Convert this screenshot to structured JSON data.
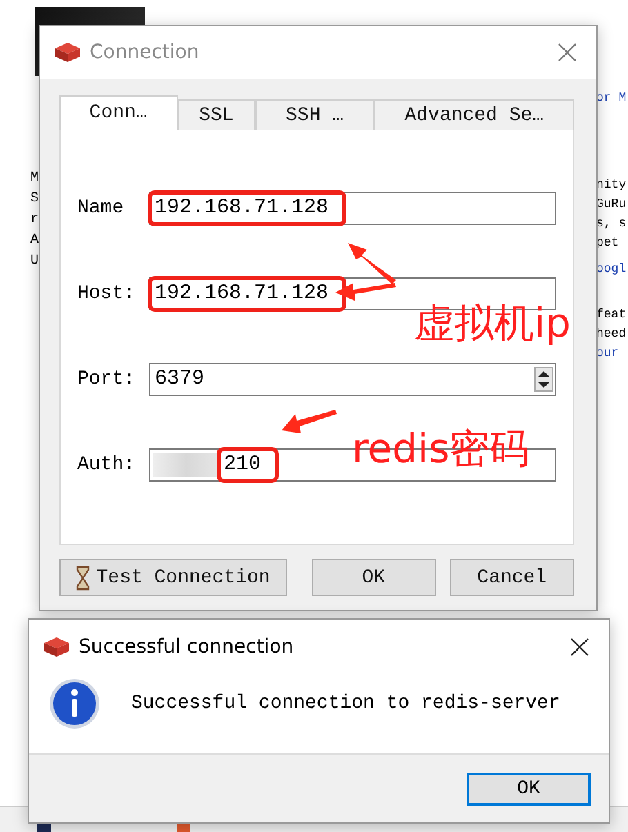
{
  "background_app": {
    "left_fragments": [
      "M",
      "S",
      "r",
      "A",
      "U"
    ],
    "right_blocks": [
      {
        "lines": [
          {
            "text": "or M",
            "kind": "link"
          }
        ]
      },
      {
        "lines": [
          {
            "text": "nity",
            "kind": "text"
          },
          {
            "text": "GuRu",
            "kind": "text"
          },
          {
            "text": "s, s",
            "kind": "text"
          },
          {
            "text": "pet",
            "kind": "text"
          }
        ]
      },
      {
        "lines": [
          {
            "text": "oogl",
            "kind": "link"
          }
        ]
      },
      {
        "lines": [
          {
            "text": "feat",
            "kind": "text"
          },
          {
            "text": "heed",
            "kind": "text"
          },
          {
            "text": "our",
            "kind": "link"
          }
        ]
      }
    ]
  },
  "connection_dialog": {
    "title": "Connection",
    "tabs": [
      {
        "label": "Conn…",
        "selected": true
      },
      {
        "label": "SSL",
        "selected": false
      },
      {
        "label": "SSH …",
        "selected": false
      },
      {
        "label": "Advanced Se…",
        "selected": false
      }
    ],
    "fields": [
      {
        "label": "Name",
        "value": "192.168.71.128",
        "kind": "text",
        "highlighted": true
      },
      {
        "label": "Host:",
        "value": "192.168.71.128",
        "kind": "text",
        "highlighted": true
      },
      {
        "label": "Port:",
        "value": "6379",
        "kind": "spinner",
        "highlighted": false
      },
      {
        "label": "Auth:",
        "value": "210",
        "kind": "masked",
        "highlighted": true
      }
    ],
    "buttons": [
      {
        "label": "Test Connection",
        "kind": "test"
      },
      {
        "label": "OK",
        "kind": "plain"
      },
      {
        "label": "Cancel",
        "kind": "plain"
      }
    ]
  },
  "message_dialog": {
    "title": "Successful connection",
    "message": "Successful connection to redis-server",
    "button": "OK"
  },
  "annotations": [
    {
      "text": "虚拟机ip",
      "kind": "host"
    },
    {
      "text": "redis密码",
      "kind": "auth"
    }
  ]
}
